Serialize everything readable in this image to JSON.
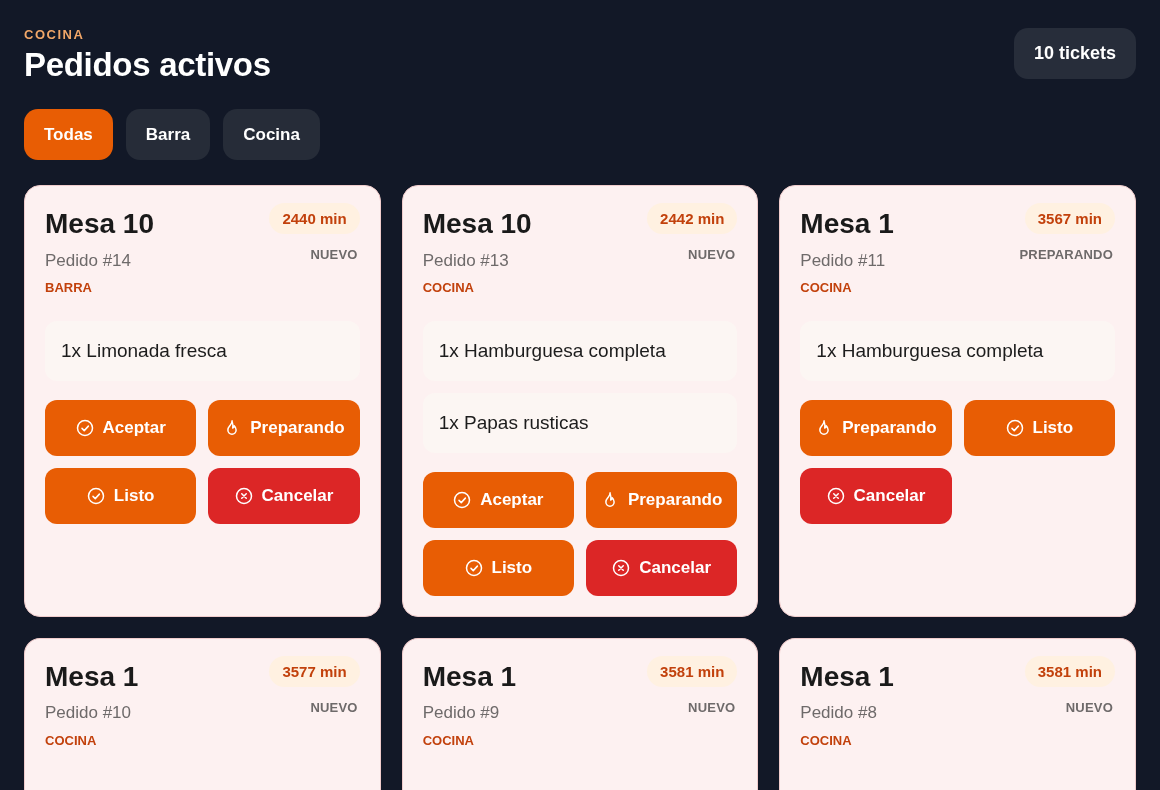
{
  "header": {
    "eyebrow": "COCINA",
    "title": "Pedidos activos",
    "count": "10 tickets"
  },
  "filters": [
    {
      "label": "Todas",
      "selected": true
    },
    {
      "label": "Barra",
      "selected": false
    },
    {
      "label": "Cocina",
      "selected": false
    }
  ],
  "orders": [
    {
      "table": "Mesa 10",
      "order": "Pedido #14",
      "station": "BARRA",
      "elapsed": "2440 min",
      "status": "NUEVO",
      "items": [
        "1x Limonada fresca"
      ],
      "actions": [
        {
          "kind": "accept",
          "label": "Aceptar"
        },
        {
          "kind": "preparing",
          "label": "Preparando"
        },
        {
          "kind": "ready",
          "label": "Listo"
        },
        {
          "kind": "cancel",
          "label": "Cancelar"
        }
      ]
    },
    {
      "table": "Mesa 10",
      "order": "Pedido #13",
      "station": "COCINA",
      "elapsed": "2442 min",
      "status": "NUEVO",
      "items": [
        "1x Hamburguesa completa",
        "1x Papas rusticas"
      ],
      "actions": [
        {
          "kind": "accept",
          "label": "Aceptar"
        },
        {
          "kind": "preparing",
          "label": "Preparando"
        },
        {
          "kind": "ready",
          "label": "Listo"
        },
        {
          "kind": "cancel",
          "label": "Cancelar"
        }
      ]
    },
    {
      "table": "Mesa 1",
      "order": "Pedido #11",
      "station": "COCINA",
      "elapsed": "3567 min",
      "status": "PREPARANDO",
      "items": [
        "1x Hamburguesa completa"
      ],
      "actions": [
        {
          "kind": "preparing",
          "label": "Preparando"
        },
        {
          "kind": "ready",
          "label": "Listo"
        },
        {
          "kind": "cancel",
          "label": "Cancelar"
        }
      ]
    },
    {
      "table": "Mesa 1",
      "order": "Pedido #10",
      "station": "COCINA",
      "elapsed": "3577 min",
      "status": "NUEVO"
    },
    {
      "table": "Mesa 1",
      "order": "Pedido #9",
      "station": "COCINA",
      "elapsed": "3581 min",
      "status": "NUEVO"
    },
    {
      "table": "Mesa 1",
      "order": "Pedido #8",
      "station": "COCINA",
      "elapsed": "3581 min",
      "status": "NUEVO"
    }
  ]
}
